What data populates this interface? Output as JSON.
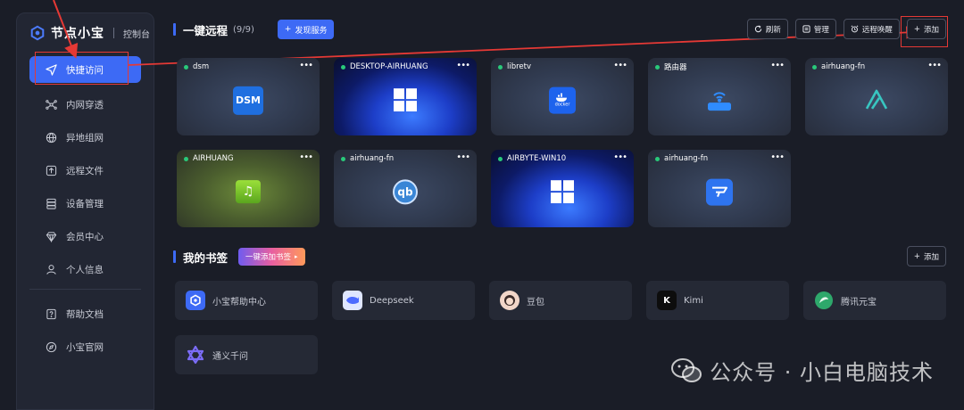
{
  "brand": {
    "name": "节点小宝",
    "subtitle": "控制台"
  },
  "sidebar": {
    "items": [
      {
        "label": "快捷访问",
        "icon": "send-icon",
        "active": true
      },
      {
        "label": "内网穿透",
        "icon": "network-icon"
      },
      {
        "label": "异地组网",
        "icon": "globe-icon"
      },
      {
        "label": "远程文件",
        "icon": "upload-icon"
      },
      {
        "label": "设备管理",
        "icon": "server-icon"
      },
      {
        "label": "会员中心",
        "icon": "diamond-icon"
      },
      {
        "label": "个人信息",
        "icon": "user-icon"
      }
    ],
    "footer_items": [
      {
        "label": "帮助文档",
        "icon": "help-doc-icon"
      },
      {
        "label": "小宝官网",
        "icon": "compass-icon"
      }
    ]
  },
  "remote": {
    "title": "一键远程",
    "count": "(9/9)",
    "discover_button": "发现服务",
    "toolbar": {
      "refresh": "刷新",
      "manage": "管理",
      "wake": "远程唤醒",
      "add": "添加"
    },
    "cards": [
      {
        "name": "dsm",
        "icon": "dsm-icon"
      },
      {
        "name": "DESKTOP-AIRHUANG",
        "icon": "windows-icon"
      },
      {
        "name": "libretv",
        "icon": "docker-icon",
        "icon_text": "docker"
      },
      {
        "name": "路由器",
        "icon": "router-icon"
      },
      {
        "name": "airhuang-fn",
        "icon": "fnos-icon"
      },
      {
        "name": "AIRHUANG",
        "icon": "music-icon"
      },
      {
        "name": "airhuang-fn",
        "icon": "qbittorrent-icon",
        "icon_text": "qb"
      },
      {
        "name": "AIRBYTE-WIN10",
        "icon": "windows-icon"
      },
      {
        "name": "airhuang-fn",
        "icon": "app-icon"
      }
    ],
    "dsm_text": "DSM"
  },
  "bookmarks": {
    "title": "我的书签",
    "quick_add": "一键添加书签",
    "add": "添加",
    "items": [
      {
        "label": "小宝帮助中心",
        "icon": "xiaobao-icon"
      },
      {
        "label": "Deepseek",
        "icon": "deepseek-icon"
      },
      {
        "label": "豆包",
        "icon": "doubao-icon"
      },
      {
        "label": "Kimi",
        "icon": "kimi-icon",
        "icon_text": "K"
      },
      {
        "label": "腾讯元宝",
        "icon": "yuanbao-icon"
      },
      {
        "label": "通义千问",
        "icon": "tongyi-icon"
      }
    ]
  },
  "watermark": {
    "text": "公众号 · 小白电脑技术"
  },
  "colors": {
    "accent": "#3d6af5",
    "online": "#29c97a",
    "highlight": "#e53935"
  }
}
